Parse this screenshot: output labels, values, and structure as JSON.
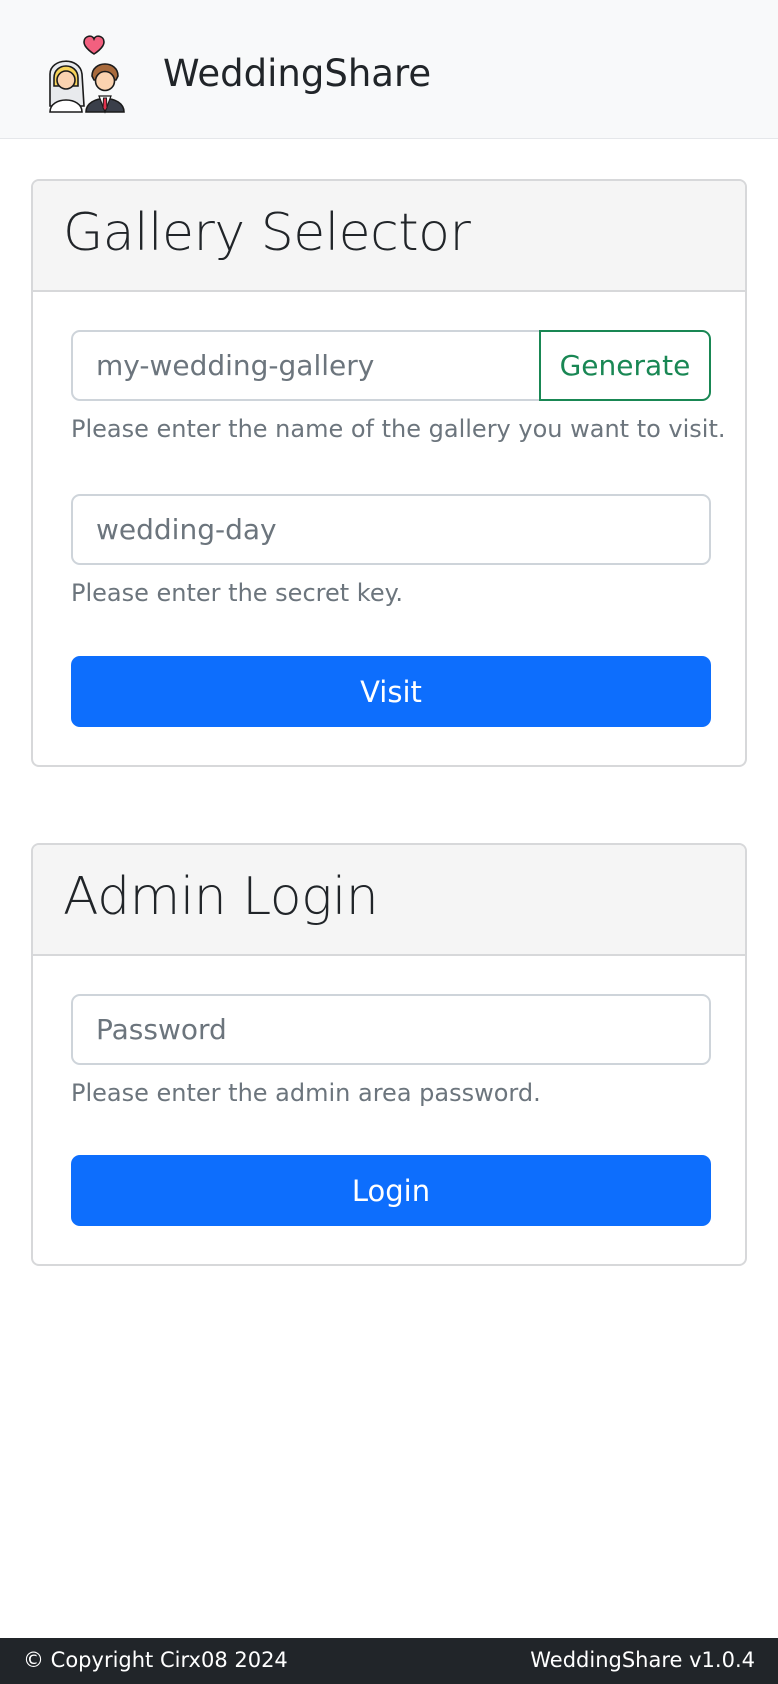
{
  "navbar": {
    "brand_name": "WeddingShare",
    "logo_icon": "bride-groom-heart-icon"
  },
  "gallery_selector": {
    "title": "Gallery Selector",
    "gallery_input": {
      "value": "",
      "placeholder": "my-wedding-gallery"
    },
    "generate_label": "Generate",
    "gallery_help": "Please enter the name of the gallery you want to visit.",
    "secret_input": {
      "value": "",
      "placeholder": "wedding-day"
    },
    "secret_help": "Please enter the secret key.",
    "visit_label": "Visit"
  },
  "admin_login": {
    "title": "Admin Login",
    "password_input": {
      "value": "",
      "placeholder": "Password"
    },
    "password_help": "Please enter the admin area password.",
    "login_label": "Login"
  },
  "footer": {
    "copyright": "© Copyright Cirx08 2024",
    "version": "WeddingShare v1.0.4"
  },
  "colors": {
    "primary": "#0d6efd",
    "success": "#198754",
    "footer_bg": "#212529",
    "navbar_bg": "#f8f9fa"
  }
}
